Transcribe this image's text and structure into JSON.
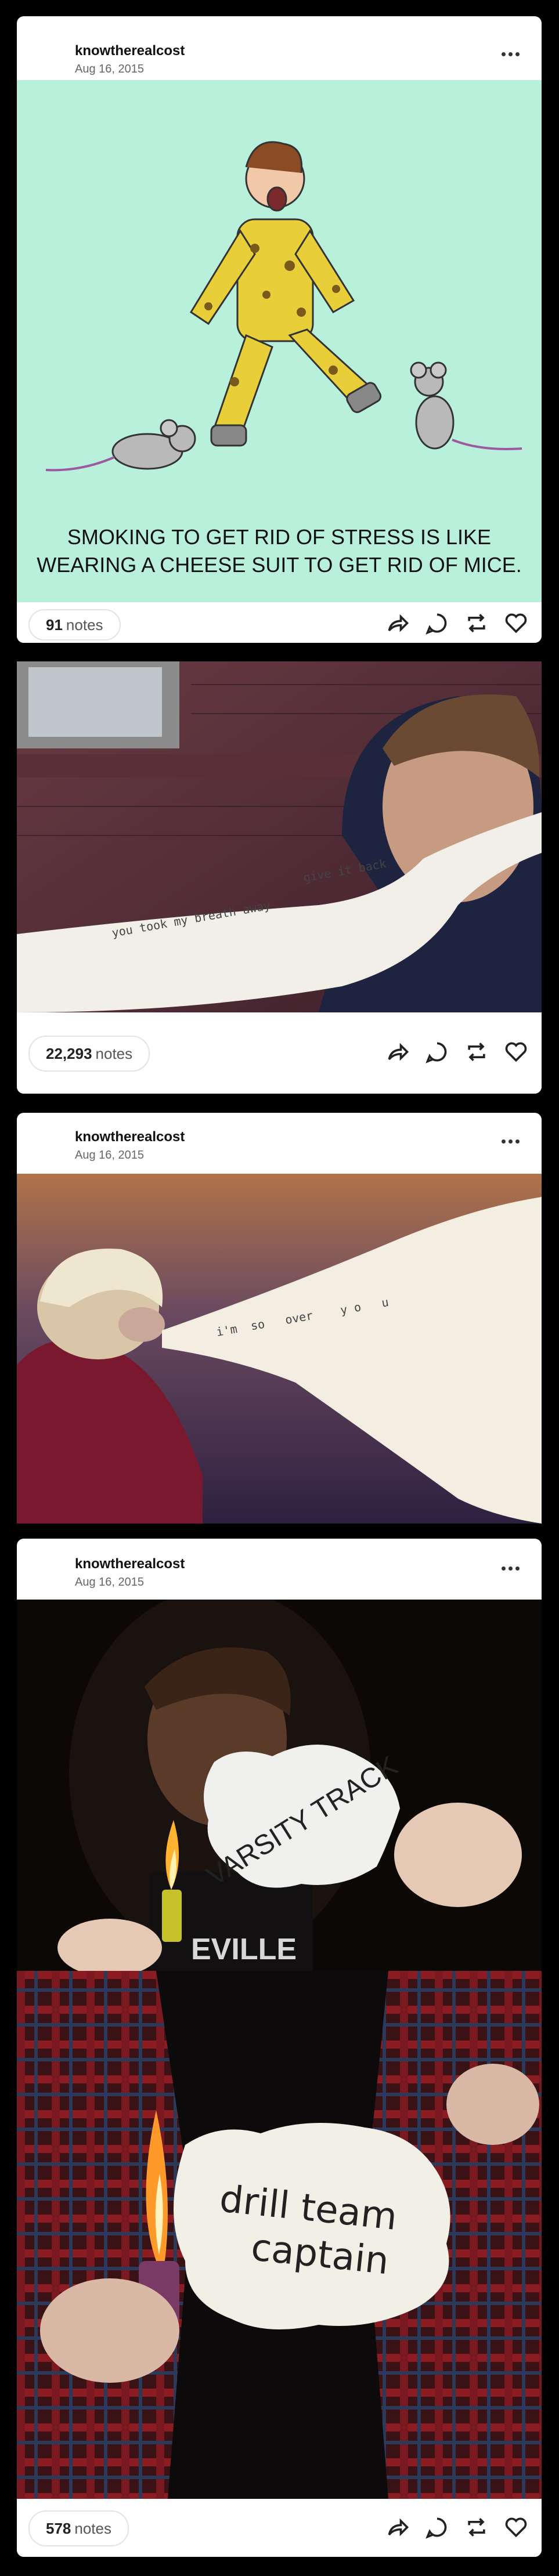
{
  "posts": [
    {
      "blog_name": "knowtherealcost",
      "date": "Aug 16, 2015",
      "image_caption_line1": "SMOKING TO GET RID OF STRESS IS LIKE",
      "image_caption_line2": "WEARING A CHEESE SUIT TO GET RID OF MICE.",
      "notes_count": "91",
      "notes_label": "notes"
    },
    {
      "torn_text_1": "you took my breath away",
      "torn_text_2": "give it back",
      "notes_count": "22,293",
      "notes_label": "notes"
    },
    {
      "blog_name": "knowtherealcost",
      "date": "Aug 16, 2015",
      "torn_text": "i'm  so   over    y o   u"
    },
    {
      "blog_name": "knowtherealcost",
      "date": "Aug 16, 2015",
      "paper_text_1": "VARSITY TRACK",
      "shirt_text": "EVILLE",
      "paper_text_2_line1": "drill team",
      "paper_text_2_line2": "captain",
      "notes_count": "578",
      "notes_label": "notes"
    }
  ],
  "icons": [
    "more-icon",
    "share-icon",
    "reply-icon",
    "reblog-icon",
    "like-icon"
  ],
  "colors": {
    "cheese_bg": "#b8f0dc",
    "cheese_yellow": "#e8cf3a",
    "page_bg": "#000000"
  }
}
